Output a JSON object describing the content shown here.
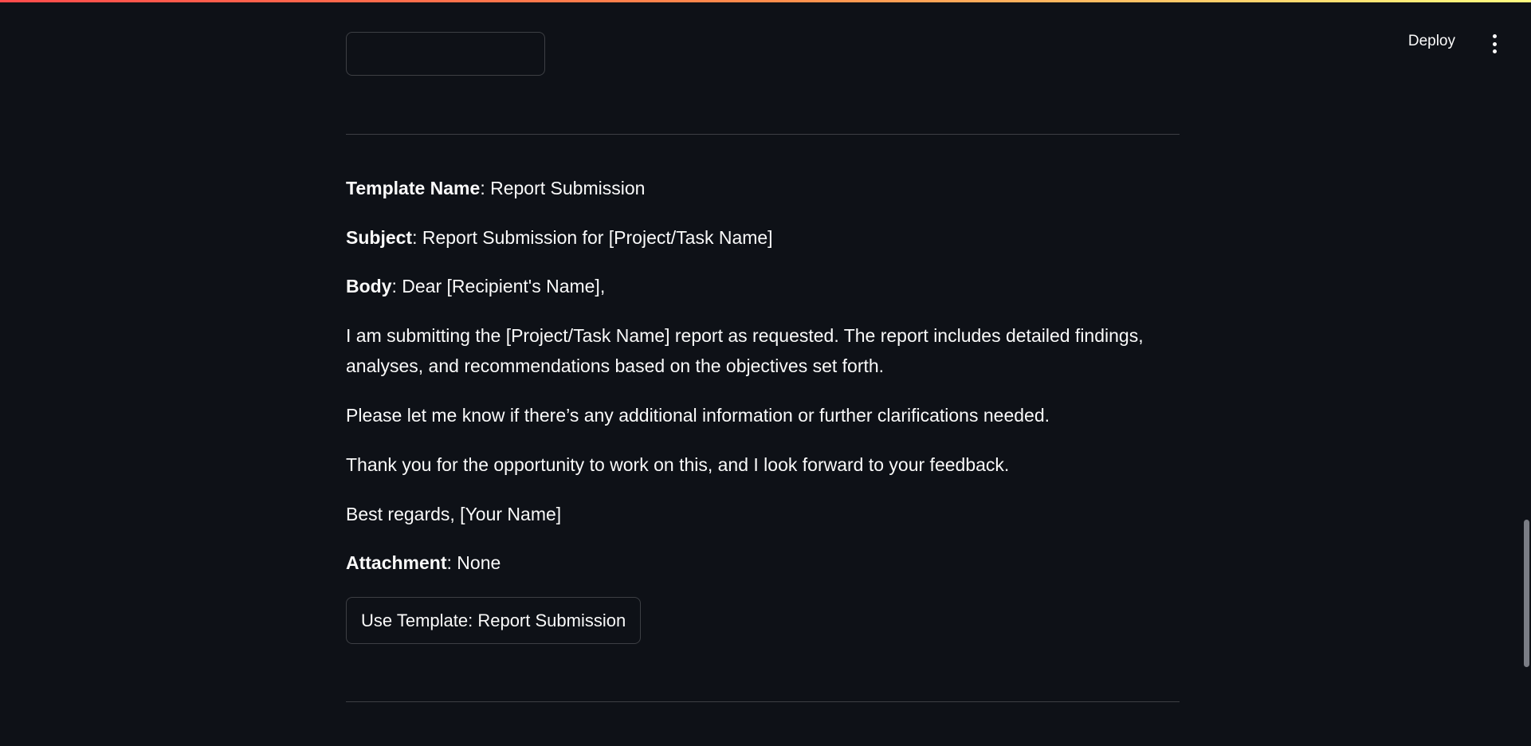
{
  "header": {
    "deploy_label": "Deploy",
    "menu_icon": "more-vertical-icon"
  },
  "template": {
    "name_label": "Template Name",
    "name_value": ": Report Submission",
    "subject_label": "Subject",
    "subject_value": ": Report Submission for [Project/Task Name]",
    "body_label": "Body",
    "body_value": ": Dear [Recipient's Name],",
    "body_paragraphs": [
      "I am submitting the [Project/Task Name] report as requested. The report includes detailed findings, analyses, and recommendations based on the objectives set forth.",
      "Please let me know if there’s any additional information or further clarifications needed.",
      "Thank you for the opportunity to work on this, and I look forward to your feedback.",
      "Best regards, [Your Name]"
    ],
    "attachment_label": "Attachment",
    "attachment_value": ": None",
    "button_label": "Use Template: Report Submission"
  }
}
